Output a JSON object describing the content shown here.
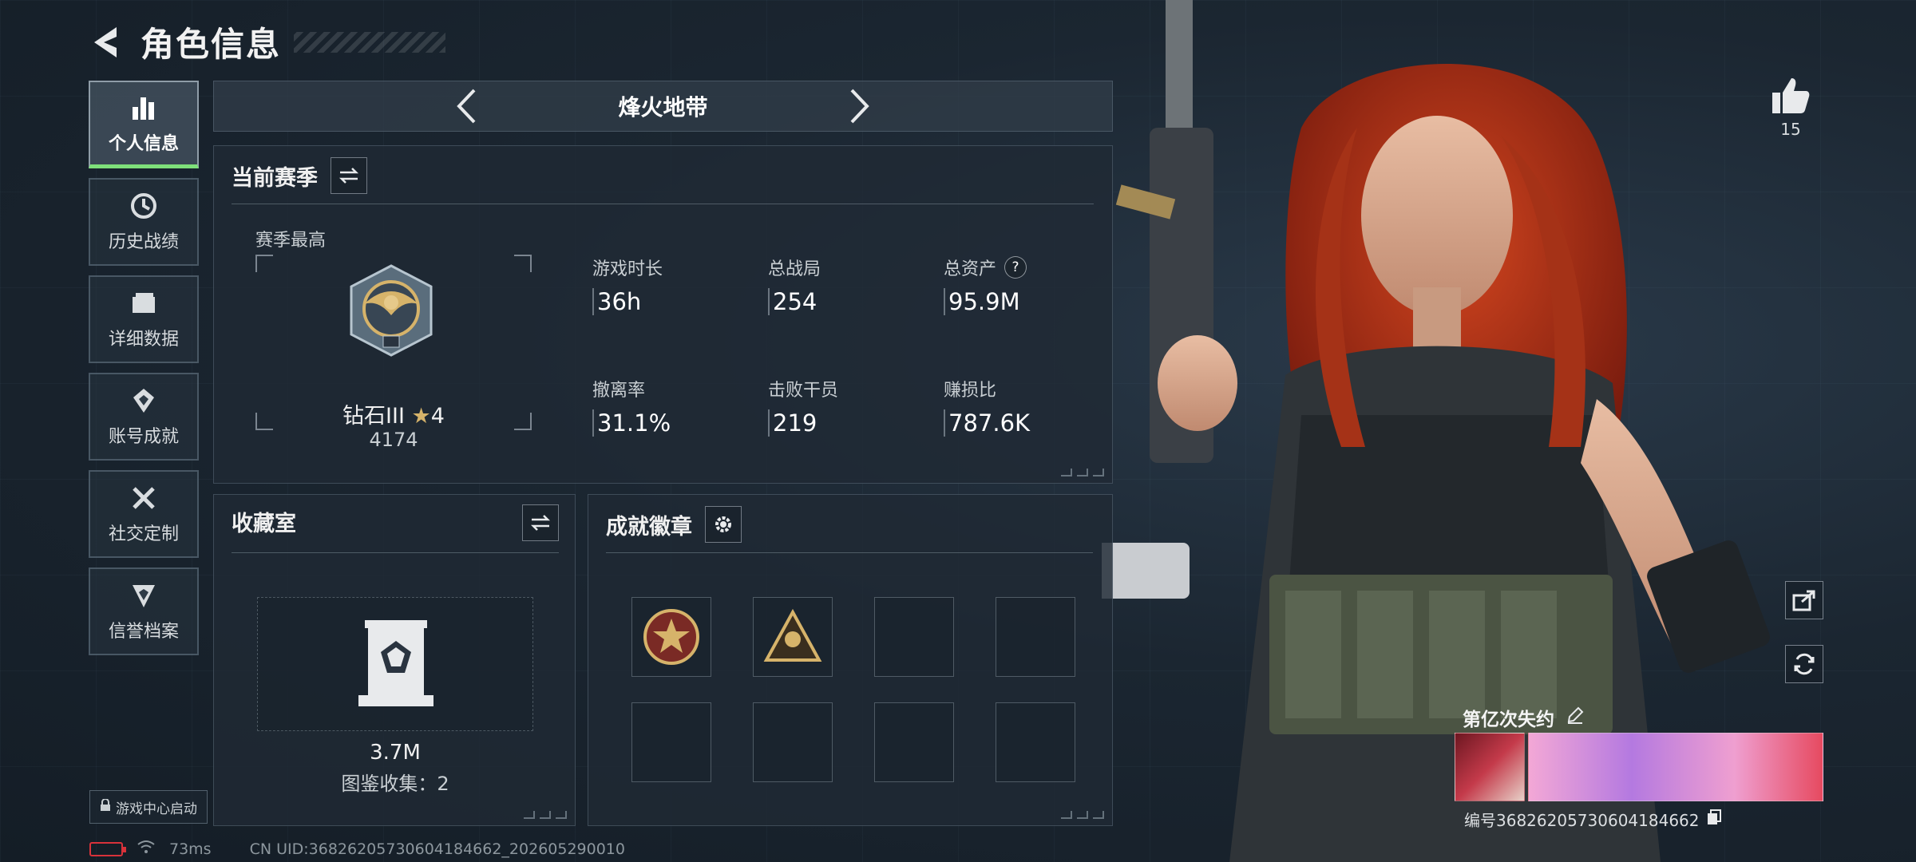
{
  "header": {
    "title": "角色信息"
  },
  "sidebar": {
    "items": [
      {
        "label": "个人信息",
        "icon": "bar-chart-icon",
        "active": true
      },
      {
        "label": "历史战绩",
        "icon": "history-icon",
        "active": false
      },
      {
        "label": "详细数据",
        "icon": "folder-icon",
        "active": false
      },
      {
        "label": "账号成就",
        "icon": "achievement-icon",
        "active": false
      },
      {
        "label": "社交定制",
        "icon": "tools-icon",
        "active": false
      },
      {
        "label": "信誉档案",
        "icon": "shield-icon",
        "active": false
      }
    ],
    "launch_label": "游戏中心启动"
  },
  "status": {
    "ping": "73ms",
    "uid": "CN UID:3682620573060418466​2_202605290010"
  },
  "mode": {
    "title": "烽火地带"
  },
  "season": {
    "title": "当前赛季",
    "best_label": "赛季最高",
    "rank_name": "钻石III",
    "rank_stars": "4",
    "rank_score": "4174",
    "stats": [
      {
        "label": "游戏时长",
        "value": "36h"
      },
      {
        "label": "总战局",
        "value": "254"
      },
      {
        "label": "总资产",
        "value": "95.9M",
        "help": "?"
      },
      {
        "label": "撤离率",
        "value": "31.1%"
      },
      {
        "label": "击败干员",
        "value": "219"
      },
      {
        "label": "赚损比",
        "value": "787.6K"
      }
    ]
  },
  "collection": {
    "title": "收藏室",
    "value": "3.7M",
    "count_text": "图鉴收集：2"
  },
  "achievements": {
    "title": "成就徽章"
  },
  "likes": {
    "count": "15"
  },
  "character": {
    "name": "第亿次失约",
    "serial": "编号3682620573060418466​2"
  },
  "colors": {
    "accent_green": "#7ee07a",
    "battery_red": "#d8323a"
  }
}
